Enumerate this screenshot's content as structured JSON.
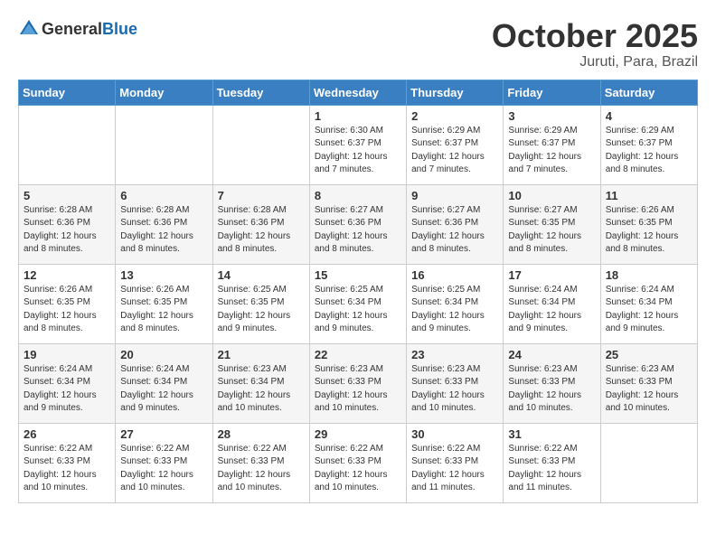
{
  "header": {
    "logo_general": "General",
    "logo_blue": "Blue",
    "month_title": "October 2025",
    "location": "Juruti, Para, Brazil"
  },
  "days_of_week": [
    "Sunday",
    "Monday",
    "Tuesday",
    "Wednesday",
    "Thursday",
    "Friday",
    "Saturday"
  ],
  "weeks": [
    [
      {
        "day": "",
        "info": ""
      },
      {
        "day": "",
        "info": ""
      },
      {
        "day": "",
        "info": ""
      },
      {
        "day": "1",
        "info": "Sunrise: 6:30 AM\nSunset: 6:37 PM\nDaylight: 12 hours\nand 7 minutes."
      },
      {
        "day": "2",
        "info": "Sunrise: 6:29 AM\nSunset: 6:37 PM\nDaylight: 12 hours\nand 7 minutes."
      },
      {
        "day": "3",
        "info": "Sunrise: 6:29 AM\nSunset: 6:37 PM\nDaylight: 12 hours\nand 7 minutes."
      },
      {
        "day": "4",
        "info": "Sunrise: 6:29 AM\nSunset: 6:37 PM\nDaylight: 12 hours\nand 8 minutes."
      }
    ],
    [
      {
        "day": "5",
        "info": "Sunrise: 6:28 AM\nSunset: 6:36 PM\nDaylight: 12 hours\nand 8 minutes."
      },
      {
        "day": "6",
        "info": "Sunrise: 6:28 AM\nSunset: 6:36 PM\nDaylight: 12 hours\nand 8 minutes."
      },
      {
        "day": "7",
        "info": "Sunrise: 6:28 AM\nSunset: 6:36 PM\nDaylight: 12 hours\nand 8 minutes."
      },
      {
        "day": "8",
        "info": "Sunrise: 6:27 AM\nSunset: 6:36 PM\nDaylight: 12 hours\nand 8 minutes."
      },
      {
        "day": "9",
        "info": "Sunrise: 6:27 AM\nSunset: 6:36 PM\nDaylight: 12 hours\nand 8 minutes."
      },
      {
        "day": "10",
        "info": "Sunrise: 6:27 AM\nSunset: 6:35 PM\nDaylight: 12 hours\nand 8 minutes."
      },
      {
        "day": "11",
        "info": "Sunrise: 6:26 AM\nSunset: 6:35 PM\nDaylight: 12 hours\nand 8 minutes."
      }
    ],
    [
      {
        "day": "12",
        "info": "Sunrise: 6:26 AM\nSunset: 6:35 PM\nDaylight: 12 hours\nand 8 minutes."
      },
      {
        "day": "13",
        "info": "Sunrise: 6:26 AM\nSunset: 6:35 PM\nDaylight: 12 hours\nand 8 minutes."
      },
      {
        "day": "14",
        "info": "Sunrise: 6:25 AM\nSunset: 6:35 PM\nDaylight: 12 hours\nand 9 minutes."
      },
      {
        "day": "15",
        "info": "Sunrise: 6:25 AM\nSunset: 6:34 PM\nDaylight: 12 hours\nand 9 minutes."
      },
      {
        "day": "16",
        "info": "Sunrise: 6:25 AM\nSunset: 6:34 PM\nDaylight: 12 hours\nand 9 minutes."
      },
      {
        "day": "17",
        "info": "Sunrise: 6:24 AM\nSunset: 6:34 PM\nDaylight: 12 hours\nand 9 minutes."
      },
      {
        "day": "18",
        "info": "Sunrise: 6:24 AM\nSunset: 6:34 PM\nDaylight: 12 hours\nand 9 minutes."
      }
    ],
    [
      {
        "day": "19",
        "info": "Sunrise: 6:24 AM\nSunset: 6:34 PM\nDaylight: 12 hours\nand 9 minutes."
      },
      {
        "day": "20",
        "info": "Sunrise: 6:24 AM\nSunset: 6:34 PM\nDaylight: 12 hours\nand 9 minutes."
      },
      {
        "day": "21",
        "info": "Sunrise: 6:23 AM\nSunset: 6:34 PM\nDaylight: 12 hours\nand 10 minutes."
      },
      {
        "day": "22",
        "info": "Sunrise: 6:23 AM\nSunset: 6:33 PM\nDaylight: 12 hours\nand 10 minutes."
      },
      {
        "day": "23",
        "info": "Sunrise: 6:23 AM\nSunset: 6:33 PM\nDaylight: 12 hours\nand 10 minutes."
      },
      {
        "day": "24",
        "info": "Sunrise: 6:23 AM\nSunset: 6:33 PM\nDaylight: 12 hours\nand 10 minutes."
      },
      {
        "day": "25",
        "info": "Sunrise: 6:23 AM\nSunset: 6:33 PM\nDaylight: 12 hours\nand 10 minutes."
      }
    ],
    [
      {
        "day": "26",
        "info": "Sunrise: 6:22 AM\nSunset: 6:33 PM\nDaylight: 12 hours\nand 10 minutes."
      },
      {
        "day": "27",
        "info": "Sunrise: 6:22 AM\nSunset: 6:33 PM\nDaylight: 12 hours\nand 10 minutes."
      },
      {
        "day": "28",
        "info": "Sunrise: 6:22 AM\nSunset: 6:33 PM\nDaylight: 12 hours\nand 10 minutes."
      },
      {
        "day": "29",
        "info": "Sunrise: 6:22 AM\nSunset: 6:33 PM\nDaylight: 12 hours\nand 10 minutes."
      },
      {
        "day": "30",
        "info": "Sunrise: 6:22 AM\nSunset: 6:33 PM\nDaylight: 12 hours\nand 11 minutes."
      },
      {
        "day": "31",
        "info": "Sunrise: 6:22 AM\nSunset: 6:33 PM\nDaylight: 12 hours\nand 11 minutes."
      },
      {
        "day": "",
        "info": ""
      }
    ]
  ]
}
